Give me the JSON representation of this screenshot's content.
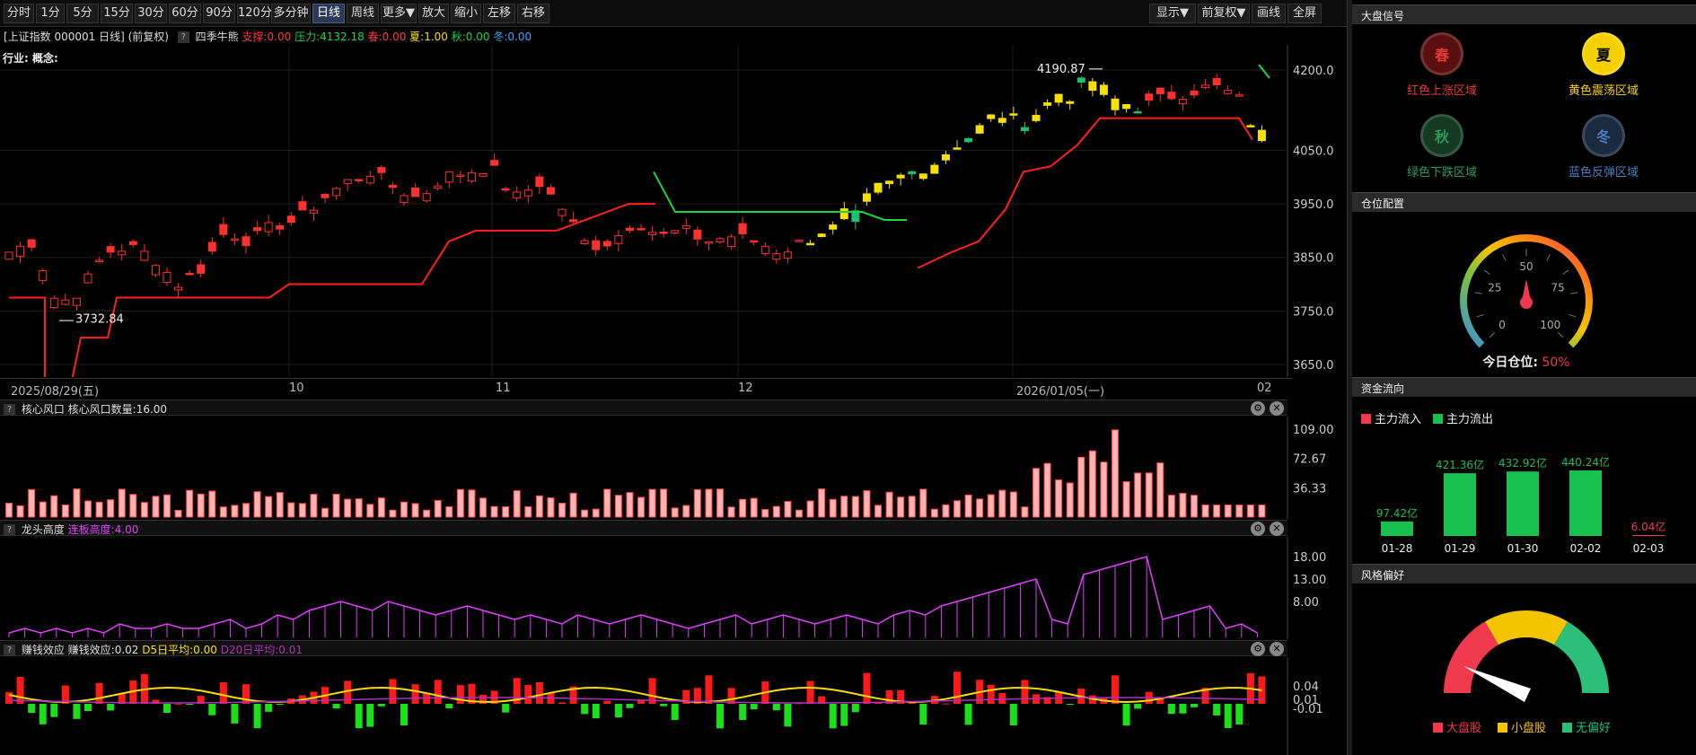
{
  "toolbar": {
    "buttons": [
      "分时",
      "1分",
      "5分",
      "15分",
      "30分",
      "60分",
      "90分",
      "120分",
      "多分钟",
      "日线",
      "周线",
      "更多▼",
      "放大",
      "缩小",
      "左移",
      "右移"
    ],
    "active": "日线",
    "right": [
      "显示▼",
      "前复权▼",
      "画线",
      "全屏"
    ]
  },
  "main": {
    "title": "[上证指数 000001 日线] (前复权)",
    "indicator": "四季牛熊",
    "support": "支撑:0.00",
    "pressure": "压力:4132.18",
    "spring": "春:0.00",
    "summer": "夏:1.00",
    "autumn": "秋:0.00",
    "winter": "冬:0.00",
    "industry": "行业: 概念:",
    "high_label": "4190.87",
    "low_label": "3732.84",
    "y_ticks": [
      "4200.0",
      "4050.0",
      "3950.0",
      "3850.0",
      "3750.0",
      "3650.0"
    ],
    "x_labels": [
      "2025/08/29(五)",
      "10",
      "11",
      "12",
      "2026/01/05(一)",
      "02"
    ]
  },
  "panel1": {
    "title": "核心风口",
    "value": "核心风口数量:16.00",
    "ticks": [
      "109.00",
      "72.67",
      "36.33"
    ]
  },
  "panel2": {
    "title": "龙头高度",
    "value": "连板高度:4.00",
    "ticks": [
      "18.00",
      "13.00",
      "8.00"
    ]
  },
  "panel3": {
    "title": "赚钱效应",
    "value": "赚钱效应:0.02",
    "d5": "D5日平均:0.00",
    "d20": "D20日平均:0.01",
    "ticks": [
      "0.04",
      "0.01",
      "-0.01"
    ]
  },
  "sidebar": {
    "signal": {
      "title": "大盘信号",
      "items": [
        {
          "char": "春",
          "label": "红色上涨区域",
          "color": "#e83a3a",
          "bg": "#5a1010"
        },
        {
          "char": "夏",
          "label": "黄色震荡区域",
          "color": "#f5d000",
          "bg": "#f5d000"
        },
        {
          "char": "秋",
          "label": "绿色下跌区域",
          "color": "#2f9a5c",
          "bg": "#143a24"
        },
        {
          "char": "冬",
          "label": "蓝色反弹区域",
          "color": "#4a7fc0",
          "bg": "#1a2a40"
        }
      ]
    },
    "position": {
      "title": "仓位配置",
      "ticks": [
        "0",
        "25",
        "50",
        "75",
        "100"
      ],
      "today_label": "今日仓位:",
      "today_value": "50%",
      "value": 0.5
    },
    "flow": {
      "title": "资金流向",
      "in_label": "主力流入",
      "out_label": "主力流出",
      "bars": [
        {
          "date": "01-28",
          "value": 97.42,
          "label": "97.42亿",
          "color": "#18c050"
        },
        {
          "date": "01-29",
          "value": 421.36,
          "label": "421.36亿",
          "color": "#18c050"
        },
        {
          "date": "01-30",
          "value": 432.92,
          "label": "432.92亿",
          "color": "#18c050"
        },
        {
          "date": "02-02",
          "value": 440.24,
          "label": "440.24亿",
          "color": "#18c050"
        },
        {
          "date": "02-03",
          "value": 6.04,
          "label": "6.04亿",
          "color": "#e83a5a"
        }
      ]
    },
    "style": {
      "title": "风格偏好",
      "legend": [
        {
          "label": "大盘股",
          "color": "#f0384f"
        },
        {
          "label": "小盘股",
          "color": "#f5c400"
        },
        {
          "label": "无偏好",
          "color": "#2bbf7a"
        }
      ]
    }
  }
}
